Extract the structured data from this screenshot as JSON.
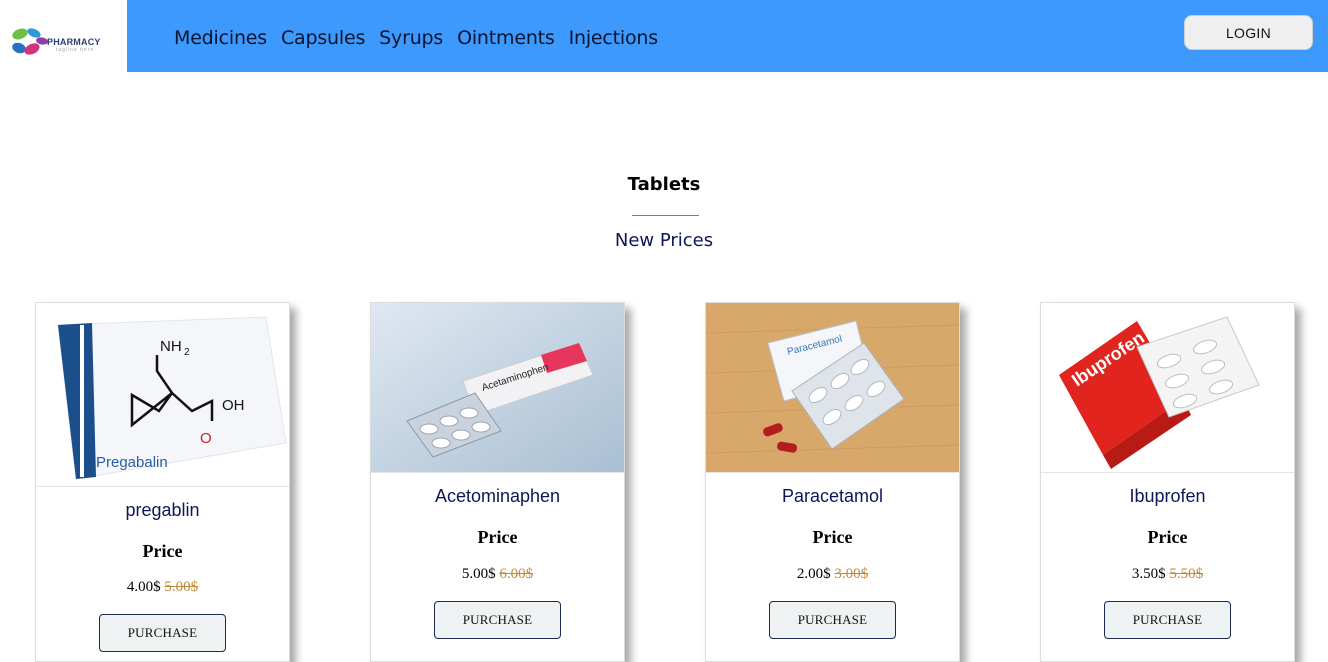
{
  "header": {
    "logo": {
      "name": "PHARMACY",
      "tagline": "tagline here"
    },
    "nav": [
      "Medicines",
      "Capsules",
      "Syrups",
      "Ointments",
      "Injections"
    ],
    "login_label": "LOGIN"
  },
  "section": {
    "title": "Tablets",
    "subtitle": "New Prices"
  },
  "products": [
    {
      "name": "pregablin",
      "price_label": "Price",
      "price": "4.00$",
      "old_price": "5.00$",
      "button": "PURCHASE",
      "image_text": "Pregabalin"
    },
    {
      "name": "Acetominaphen",
      "price_label": "Price",
      "price": "5.00$",
      "old_price": "6.00$",
      "button": "PURCHASE",
      "image_text": "Acetaminophen"
    },
    {
      "name": "Paracetamol",
      "price_label": "Price",
      "price": "2.00$",
      "old_price": "3.00$",
      "button": "PURCHASE",
      "image_text": "Paracetamol"
    },
    {
      "name": "Ibuprofen",
      "price_label": "Price",
      "price": "3.50$",
      "old_price": "5.50$",
      "button": "PURCHASE",
      "image_text": "Ibuprofen"
    }
  ],
  "colors": {
    "header": "#3d99fc",
    "nav_text": "#0b1431",
    "product_name": "#0e1656",
    "old_price": "#c2893a"
  }
}
